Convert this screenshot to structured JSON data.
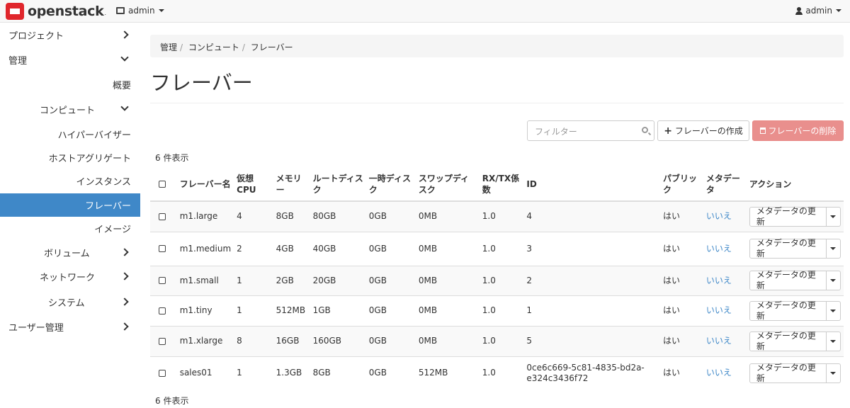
{
  "navbar": {
    "brand": "openstack",
    "brand_suffix": ".",
    "project": "admin",
    "user": "admin"
  },
  "sidebar": {
    "items": [
      {
        "label": "プロジェクト",
        "chevron": "right"
      },
      {
        "label": "管理",
        "chevron": "down"
      },
      {
        "label": "概要",
        "chevron": ""
      },
      {
        "label": "コンピュート",
        "chevron": "down"
      },
      {
        "label": "ハイパーバイザー",
        "chevron": ""
      },
      {
        "label": "ホストアグリゲート",
        "chevron": ""
      },
      {
        "label": "インスタンス",
        "chevron": ""
      },
      {
        "label": "フレーバー",
        "chevron": "",
        "active": true
      },
      {
        "label": "イメージ",
        "chevron": ""
      },
      {
        "label": "ボリューム",
        "chevron": "right"
      },
      {
        "label": "ネットワーク",
        "chevron": "right"
      },
      {
        "label": "システム",
        "chevron": "right"
      },
      {
        "label": "ユーザー管理",
        "chevron": "right"
      }
    ]
  },
  "breadcrumb": [
    "管理",
    "コンピュート",
    "フレーバー"
  ],
  "page_title": "フレーバー",
  "toolbar": {
    "filter_placeholder": "フィルター",
    "create_label": "フレーバーの作成",
    "delete_label": "フレーバーの削除"
  },
  "count_top": "6 件表示",
  "count_bottom": "6 件表示",
  "table": {
    "headers": [
      "フレーバー名",
      "仮想CPU",
      "メモリー",
      "ルートディスク",
      "一時ディスク",
      "スワップディスク",
      "RX/TX係数",
      "ID",
      "パブリック",
      "メタデータ",
      "アクション"
    ],
    "rows": [
      {
        "name": "m1.large",
        "vcpu": "4",
        "ram": "8GB",
        "root": "80GB",
        "ephemeral": "0GB",
        "swap": "0MB",
        "rxtx": "1.0",
        "id": "4",
        "public": "はい",
        "metadata": "いいえ",
        "action": "メタデータの更新"
      },
      {
        "name": "m1.medium",
        "vcpu": "2",
        "ram": "4GB",
        "root": "40GB",
        "ephemeral": "0GB",
        "swap": "0MB",
        "rxtx": "1.0",
        "id": "3",
        "public": "はい",
        "metadata": "いいえ",
        "action": "メタデータの更新"
      },
      {
        "name": "m1.small",
        "vcpu": "1",
        "ram": "2GB",
        "root": "20GB",
        "ephemeral": "0GB",
        "swap": "0MB",
        "rxtx": "1.0",
        "id": "2",
        "public": "はい",
        "metadata": "いいえ",
        "action": "メタデータの更新"
      },
      {
        "name": "m1.tiny",
        "vcpu": "1",
        "ram": "512MB",
        "root": "1GB",
        "ephemeral": "0GB",
        "swap": "0MB",
        "rxtx": "1.0",
        "id": "1",
        "public": "はい",
        "metadata": "いいえ",
        "action": "メタデータの更新"
      },
      {
        "name": "m1.xlarge",
        "vcpu": "8",
        "ram": "16GB",
        "root": "160GB",
        "ephemeral": "0GB",
        "swap": "0MB",
        "rxtx": "1.0",
        "id": "5",
        "public": "はい",
        "metadata": "いいえ",
        "action": "メタデータの更新"
      },
      {
        "name": "sales01",
        "vcpu": "1",
        "ram": "1.3GB",
        "root": "8GB",
        "ephemeral": "0GB",
        "swap": "512MB",
        "rxtx": "1.0",
        "id": "0ce6c669-5c81-4835-bd2a-e324c3436f72",
        "public": "はい",
        "metadata": "いいえ",
        "action": "メタデータの更新"
      }
    ]
  },
  "colors": {
    "accent": "#3f88c8",
    "danger": "#e98f8d",
    "brand": "#e0262c"
  }
}
